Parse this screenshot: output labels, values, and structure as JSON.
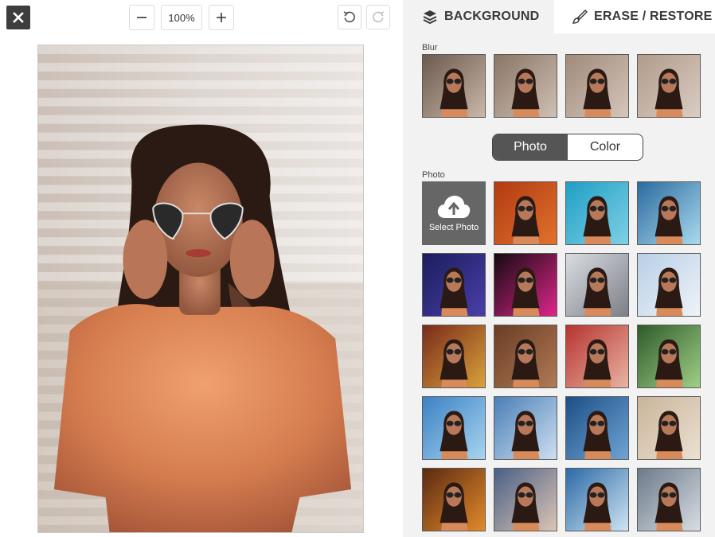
{
  "toolbar": {
    "zoom_value": "100%",
    "close_icon": "close-icon",
    "zoom_out_icon": "minus-icon",
    "zoom_in_icon": "plus-icon",
    "undo_icon": "undo-icon",
    "redo_icon": "redo-icon"
  },
  "tabs": [
    {
      "label": "BACKGROUND",
      "icon": "layers-icon",
      "active": true
    },
    {
      "label": "ERASE / RESTORE",
      "icon": "brush-icon",
      "active": false
    }
  ],
  "blur": {
    "label": "Blur",
    "thumbs": [
      "blur-level-1",
      "blur-level-2",
      "blur-level-3",
      "blur-level-4"
    ]
  },
  "mode_toggle": {
    "options": [
      "Photo",
      "Color"
    ],
    "selected": "Photo"
  },
  "photo": {
    "label": "Photo",
    "select_label": "Select Photo",
    "select_icon": "cloud-upload-icon",
    "backgrounds": [
      "autumn-leaves",
      "beach",
      "island-sea",
      "dark-blue-lights",
      "pink-neon-lights",
      "bare-trees",
      "winter-sky",
      "colorful-stripes",
      "wooden-slats",
      "red-bokeh",
      "green-leaves",
      "palm-trees",
      "sky-clouds",
      "blue-ocean",
      "tan-wall",
      "sunset",
      "city-bridge",
      "coastline",
      "city-skyline"
    ]
  },
  "colors": {
    "close_bg": "#3d3d3d",
    "panel_bg": "#f2f2f2",
    "toggle_active": "#555555",
    "select_tile": "#666666"
  }
}
